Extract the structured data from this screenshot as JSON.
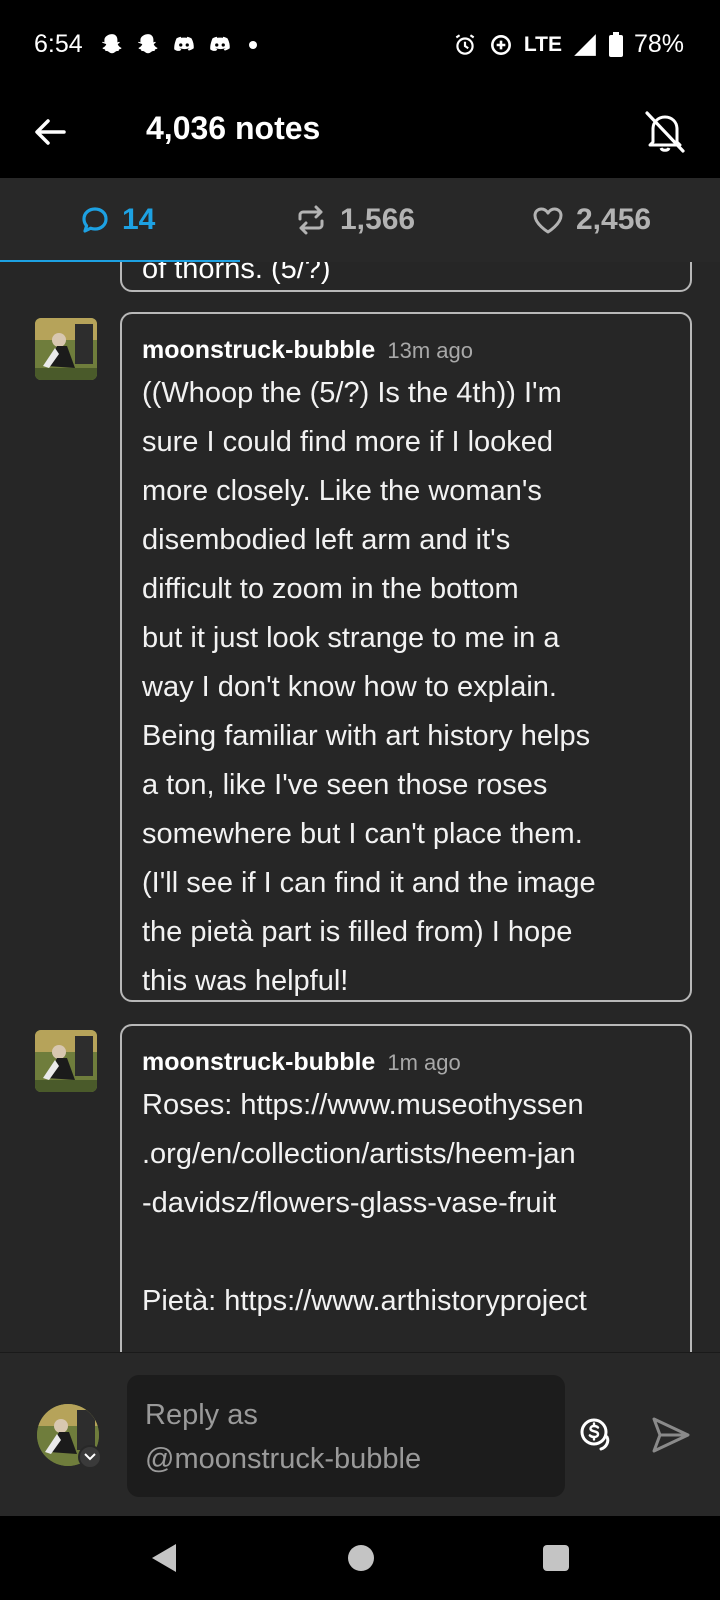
{
  "status_bar": {
    "time": "6:54",
    "network": "LTE",
    "battery": "78%",
    "icons_left": [
      "snapchat-icon",
      "snapchat-icon",
      "discord-icon",
      "discord-icon",
      "notification-dot"
    ],
    "icons_right": [
      "alarm-icon",
      "data-saver-icon",
      "lte-label",
      "signal-icon",
      "battery-icon"
    ]
  },
  "header": {
    "title": "4,036 notes",
    "back_icon": "arrow-left-icon",
    "mute_icon": "bell-off-icon"
  },
  "tabs": [
    {
      "icon": "speech-bubble-icon",
      "count": "14",
      "active": true
    },
    {
      "icon": "reblog-icon",
      "count": "1,566",
      "active": false
    },
    {
      "icon": "heart-icon",
      "count": "2,456",
      "active": false
    }
  ],
  "notes": {
    "clipped_text": "of thorns. (5/?)",
    "items": [
      {
        "user": "moonstruck-bubble",
        "time": "13m ago",
        "lines": [
          "((Whoop the (5/?) Is the 4th)) I'm",
          "sure I could find more if I looked",
          "more closely. Like the woman's",
          "disembodied left arm and it's",
          "difficult to zoom in the bottom",
          "but it just look strange to me in a",
          "way I don't know how to explain.",
          "Being familiar with art history helps",
          "a ton, like I've seen those roses",
          "somewhere but I can't place them.",
          "(I'll see if I can find it and the image",
          "the pietà part is filled from) I hope",
          "this was helpful!"
        ]
      },
      {
        "user": "moonstruck-bubble",
        "time": "1m ago",
        "lines": [
          "Roses: https://www.museothyssen",
          ".org/en/collection/artists/heem-jan",
          "-davidsz/flowers-glass-vase-fruit",
          "",
          "Pietà: https://www.arthistoryproject"
        ]
      }
    ]
  },
  "reply": {
    "placeholder_line1": "Reply as",
    "placeholder_line2": "@moonstruck-bubble",
    "tip_icon": "tip-dollar-icon",
    "send_icon": "send-icon"
  },
  "colors": {
    "accent": "#1da1e2",
    "background": "#262626",
    "border": "#b8b8b8"
  }
}
